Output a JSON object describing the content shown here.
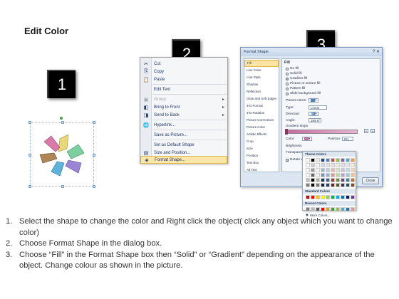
{
  "title": "Edit Color",
  "steps": [
    "1",
    "2",
    "3"
  ],
  "context_menu": {
    "items": [
      {
        "icon": "scissors-icon",
        "glyph": "✂",
        "label": "Cut",
        "disabled": false,
        "arrow": false
      },
      {
        "icon": "copy-icon",
        "glyph": "⎘",
        "label": "Copy",
        "disabled": false,
        "arrow": false
      },
      {
        "icon": "paste-icon",
        "glyph": "📋",
        "label": "Paste",
        "disabled": false,
        "arrow": false
      },
      {
        "icon": "edit-text-icon",
        "glyph": "",
        "label": "Edit Text",
        "disabled": false,
        "arrow": false
      },
      {
        "icon": "group-icon",
        "glyph": "▣",
        "label": "Group",
        "disabled": true,
        "arrow": true
      },
      {
        "icon": "bring-front-icon",
        "glyph": "◧",
        "label": "Bring to Front",
        "disabled": false,
        "arrow": true
      },
      {
        "icon": "send-back-icon",
        "glyph": "◨",
        "label": "Send to Back",
        "disabled": false,
        "arrow": true
      },
      {
        "icon": "hyperlink-icon",
        "glyph": "🌐",
        "label": "Hyperlink...",
        "disabled": false,
        "arrow": false
      },
      {
        "icon": "save-picture-icon",
        "glyph": "",
        "label": "Save as Picture...",
        "disabled": false,
        "arrow": false
      },
      {
        "icon": "default-shape-icon",
        "glyph": "",
        "label": "Set as Default Shape",
        "disabled": false,
        "arrow": false
      },
      {
        "icon": "size-position-icon",
        "glyph": "▤",
        "label": "Size and Position...",
        "disabled": false,
        "arrow": false
      },
      {
        "icon": "format-shape-icon",
        "glyph": "◈",
        "label": "Format Shape...",
        "disabled": false,
        "arrow": false
      }
    ]
  },
  "dialog": {
    "title": "Format Shape",
    "window_controls": "? ✕",
    "categories": [
      "Fill",
      "Line Color",
      "Line Style",
      "Shadow",
      "Reflection",
      "Glow and Soft Edges",
      "3-D Format",
      "3-D Rotation",
      "Picture Corrections",
      "Picture Color",
      "Artistic Effects",
      "Crop",
      "Size",
      "Position",
      "Text Box",
      "Alt Text"
    ],
    "section": "Fill",
    "options": [
      "No fill",
      "Solid fill",
      "Gradient fill",
      "Picture or texture fill",
      "Pattern fill",
      "Slide background fill"
    ],
    "preset_label": "Preset colors:",
    "type_label": "Type:",
    "type_value": "Linear",
    "direction_label": "Direction:",
    "angle_label": "Angle:",
    "angle_value": "359.9°",
    "stops_label": "Gradient stops",
    "color_label": "Color",
    "position_label": "Position:",
    "position_value": "0%",
    "brightness_label": "Brightness",
    "transparency_label": "Transparer",
    "rotate_label": "Rotate w",
    "close_label": "Close"
  },
  "picker": {
    "theme_label": "Theme Colors",
    "standard_label": "Standard Colors",
    "recent_label": "Recent Colors",
    "more_label": "More Colors...",
    "theme_top": [
      "#ffffff",
      "#000000",
      "#eeece1",
      "#1f497d",
      "#4f81bd",
      "#c0504d",
      "#9bbb59",
      "#8064a2",
      "#4bacc6",
      "#f79646"
    ],
    "standard": [
      "#c00000",
      "#ff0000",
      "#ffc000",
      "#ffff00",
      "#92d050",
      "#00b050",
      "#00b0f0",
      "#0070c0",
      "#002060",
      "#7030a0"
    ],
    "recent": [
      "#7f7f7f",
      "#b7b7b7",
      "#5a5a5a",
      "#ff0000",
      "#d8a41b",
      "#40a040",
      "#9bbb59",
      "#4bacc6",
      "#2e6db4",
      "#d99694"
    ]
  },
  "instructions": [
    {
      "num": "1.",
      "text": "Select the shape to change the color and Right click the object( click any object which you want to change color)"
    },
    {
      "num": "2.",
      "text": "Choose Format Shape in the dialog box."
    },
    {
      "num": "3.",
      "text": "Choose “Fill” in the Format Shape box then “Solid” or “Gradient” depending on the appearance of the object. Change colour as shown in the picture."
    }
  ]
}
